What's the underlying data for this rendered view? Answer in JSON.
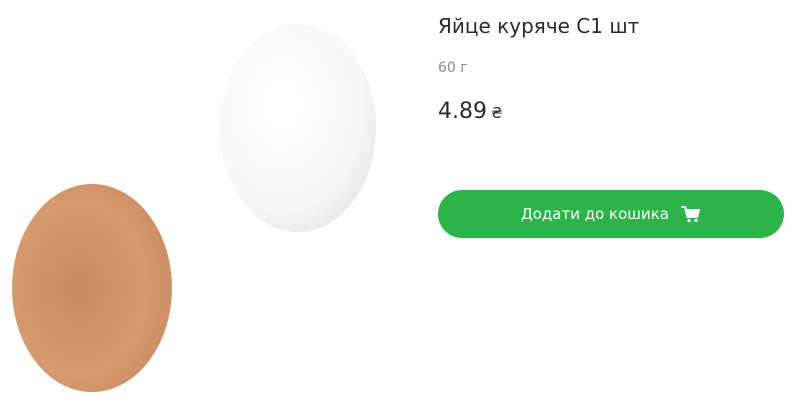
{
  "product": {
    "title": "Яйце куряче С1 шт",
    "weight": "60 г",
    "price": "4.89",
    "currency": "₴"
  },
  "cart": {
    "add_label": "Додати до кошика"
  },
  "icons": {
    "cart": "cart-icon"
  },
  "colors": {
    "accent": "#2cb34a",
    "text": "#2b2b2b",
    "muted": "#8a8a8a"
  }
}
